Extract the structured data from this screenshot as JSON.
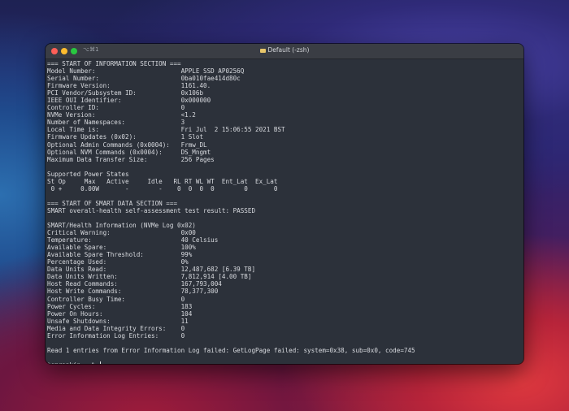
{
  "window": {
    "shortcut": "⌥⌘1",
    "title": "Default (-zsh)"
  },
  "terminal": {
    "lines": [
      "=== START OF INFORMATION SECTION ===",
      "Model Number:                       APPLE SSD AP0256Q",
      "Serial Number:                      0ba010fae414d80c",
      "Firmware Version:                   1161.40.",
      "PCI Vendor/Subsystem ID:            0x106b",
      "IEEE OUI Identifier:                0x000000",
      "Controller ID:                      0",
      "NVMe Version:                       <1.2",
      "Number of Namespaces:               3",
      "Local Time is:                      Fri Jul  2 15:06:55 2021 BST",
      "Firmware Updates (0x02):            1 Slot",
      "Optional Admin Commands (0x0004):   Frmw_DL",
      "Optional NVM Commands (0x0004):     DS_Mngmt",
      "Maximum Data Transfer Size:         256 Pages",
      "",
      "Supported Power States",
      "St Op     Max   Active     Idle   RL RT WL WT  Ent_Lat  Ex_Lat",
      " 0 +     0.00W       -        -    0  0  0  0        0       0",
      "",
      "=== START OF SMART DATA SECTION ===",
      "SMART overall-health self-assessment test result: PASSED",
      "",
      "SMART/Health Information (NVMe Log 0x02)",
      "Critical Warning:                   0x00",
      "Temperature:                        40 Celsius",
      "Available Spare:                    100%",
      "Available Spare Threshold:          99%",
      "Percentage Used:                    0%",
      "Data Units Read:                    12,487,682 [6.39 TB]",
      "Data Units Written:                 7,812,914 [4.00 TB]",
      "Host Read Commands:                 167,793,004",
      "Host Write Commands:                78,377,300",
      "Controller Busy Time:               0",
      "Power Cycles:                       183",
      "Power On Hours:                     104",
      "Unsafe Shutdowns:                   11",
      "Media and Data Integrity Errors:    0",
      "Error Information Log Entries:      0",
      "",
      "Read 1 entries from Error Information Log failed: GetLogPage failed: system=0x38, sub=0x0, code=745",
      ""
    ],
    "prompt": "tomrankin ~ % "
  }
}
